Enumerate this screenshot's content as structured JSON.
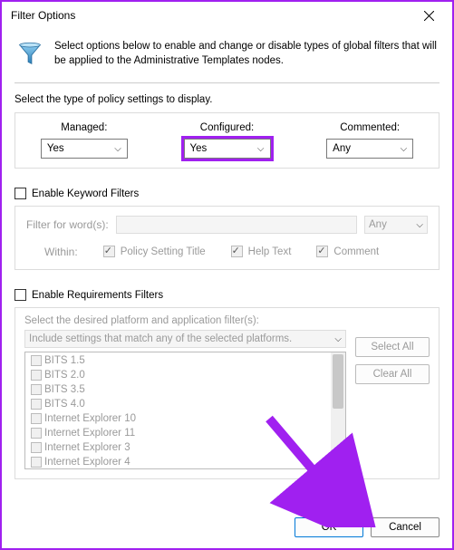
{
  "window": {
    "title": "Filter Options",
    "intro": "Select options below to enable and change or disable types of global filters that will be applied to the Administrative Templates nodes."
  },
  "policy_type": {
    "label": "Select the type of policy settings to display.",
    "managed_label": "Managed:",
    "configured_label": "Configured:",
    "commented_label": "Commented:",
    "managed_value": "Yes",
    "configured_value": "Yes",
    "commented_value": "Any"
  },
  "keyword": {
    "enable_label": "Enable Keyword Filters",
    "enabled": false,
    "filter_for_label": "Filter for word(s):",
    "match_value": "Any",
    "within_label": "Within:",
    "opt_title": "Policy Setting Title",
    "opt_help": "Help Text",
    "opt_comment": "Comment"
  },
  "requirements": {
    "enable_label": "Enable Requirements Filters",
    "enabled": false,
    "desc": "Select the desired platform and application filter(s):",
    "match_text": "Include settings that match any of the selected platforms.",
    "select_all": "Select All",
    "clear_all": "Clear All",
    "items": [
      "BITS 1.5",
      "BITS 2.0",
      "BITS 3.5",
      "BITS 4.0",
      "Internet Explorer 10",
      "Internet Explorer 11",
      "Internet Explorer 3",
      "Internet Explorer 4"
    ]
  },
  "buttons": {
    "ok": "OK",
    "cancel": "Cancel"
  }
}
